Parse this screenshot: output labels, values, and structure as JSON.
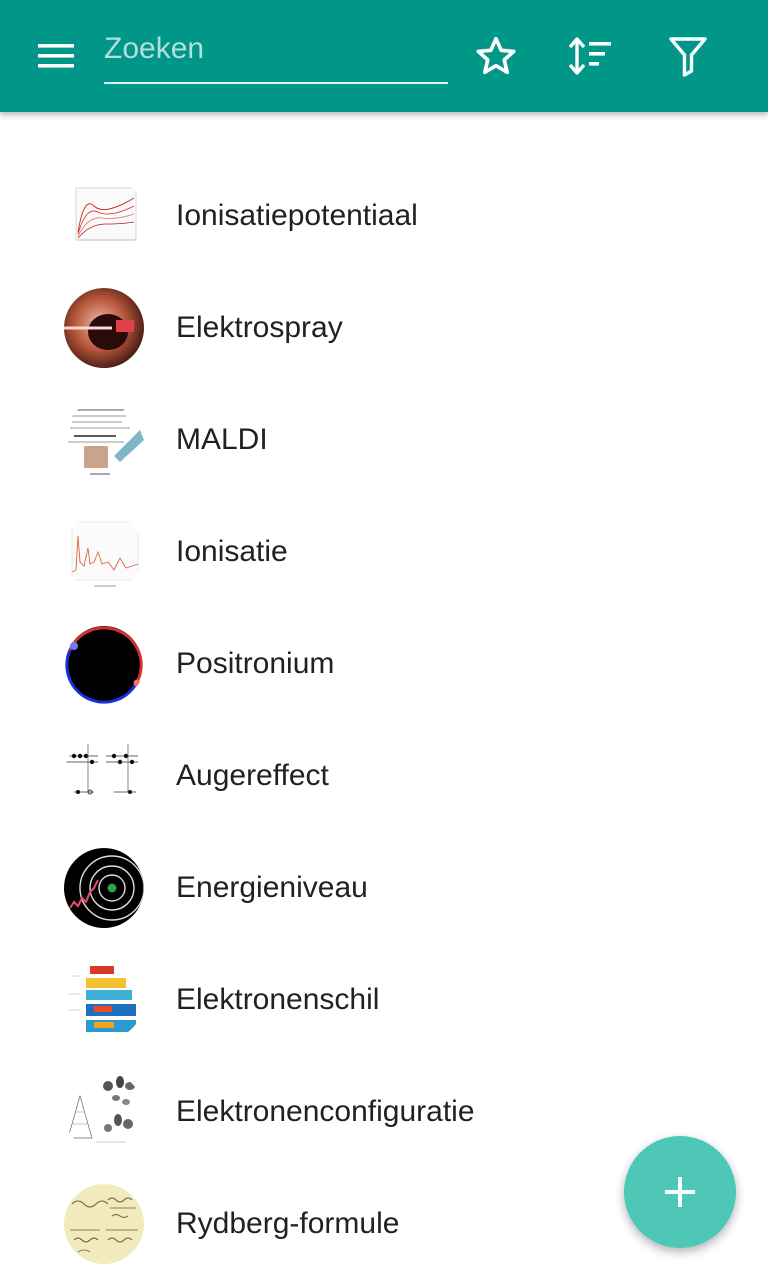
{
  "colors": {
    "appbar": "#009688",
    "fab": "#4fc7b6",
    "text": "#212121",
    "icon": "#ffffff"
  },
  "header": {
    "search_placeholder": "Zoeken",
    "icons": [
      "menu-icon",
      "star-icon",
      "sort-icon",
      "filter-icon"
    ]
  },
  "list": {
    "items": [
      {
        "label": "Ionisatiepotentiaal",
        "thumb": "ionization-potential-chart"
      },
      {
        "label": "Elektrospray",
        "thumb": "electrospray-photo"
      },
      {
        "label": "MALDI",
        "thumb": "maldi-diagram"
      },
      {
        "label": "Ionisatie",
        "thumb": "ionization-spectrum"
      },
      {
        "label": "Positronium",
        "thumb": "positronium-diagram"
      },
      {
        "label": "Augereffect",
        "thumb": "auger-effect-diagram"
      },
      {
        "label": "Energieniveau",
        "thumb": "energy-level-atom"
      },
      {
        "label": "Elektronenschil",
        "thumb": "electron-shell-heatmap"
      },
      {
        "label": "Elektronenconfiguratie",
        "thumb": "electron-configuration-orbitals"
      },
      {
        "label": "Rydberg-formule",
        "thumb": "rydberg-formula-handwriting"
      }
    ]
  },
  "fab": {
    "icon": "plus-icon"
  }
}
